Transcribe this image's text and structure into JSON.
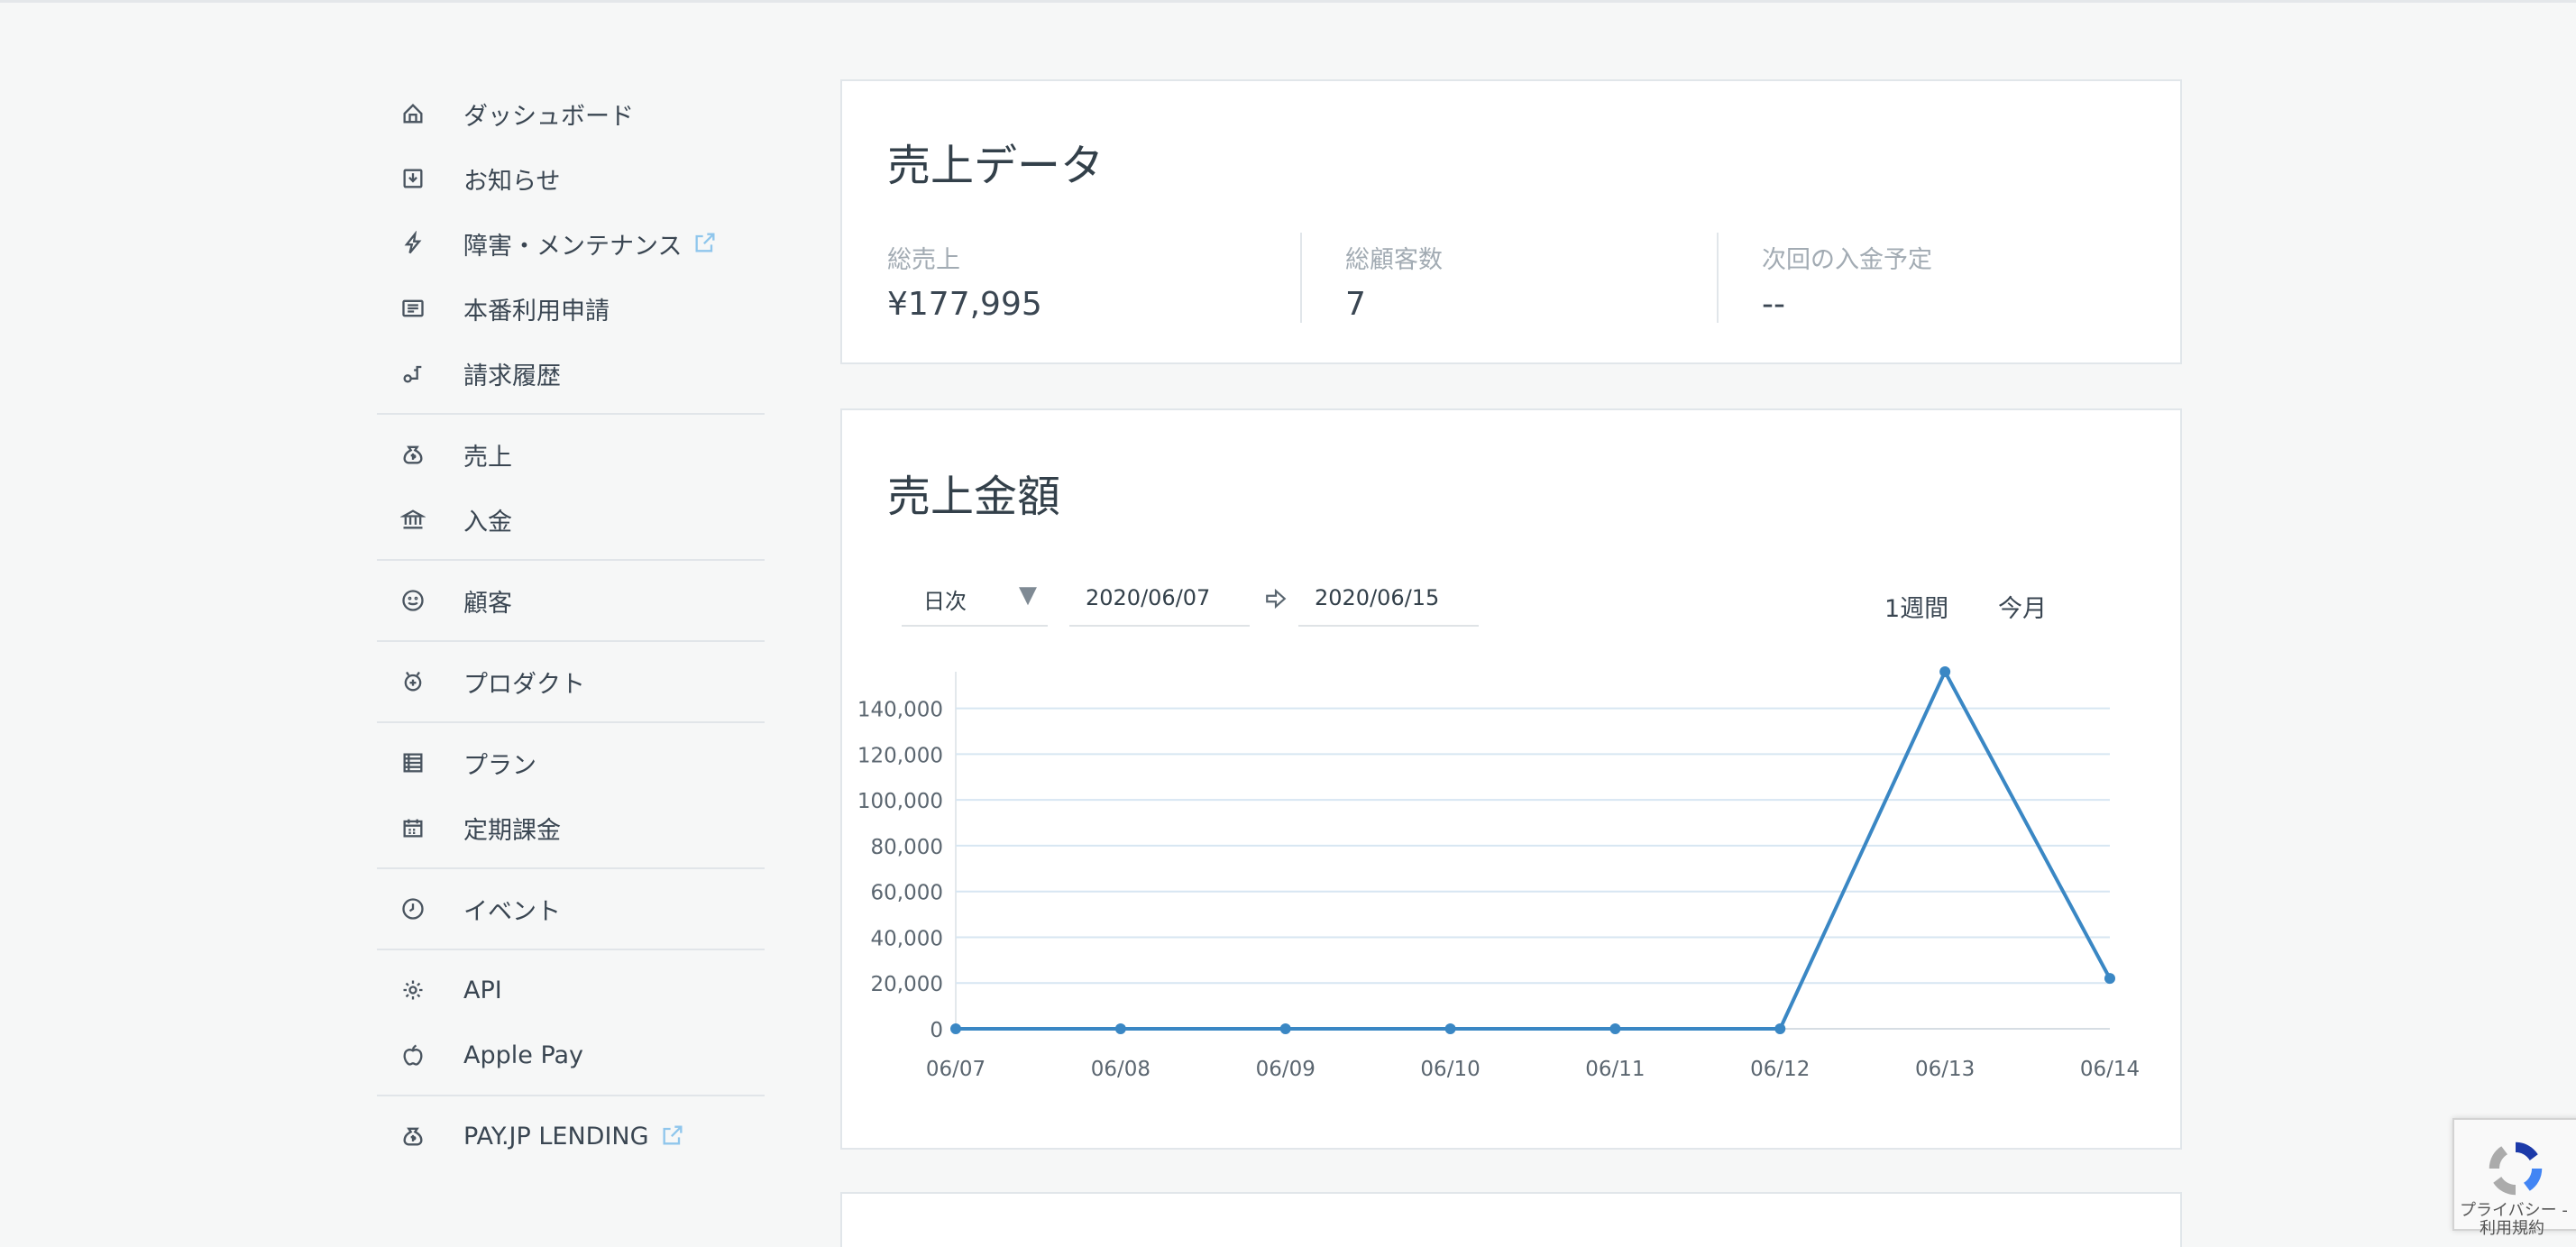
{
  "sidebar": {
    "groups": [
      [
        {
          "label": "ダッシュボード",
          "icon": "home-icon"
        },
        {
          "label": "お知らせ",
          "icon": "inbox-icon"
        },
        {
          "label": "障害・メンテナンス",
          "icon": "lightning-icon",
          "external": true
        },
        {
          "label": "本番利用申請",
          "icon": "document-icon"
        },
        {
          "label": "請求履歴",
          "icon": "billing-icon"
        }
      ],
      [
        {
          "label": "売上",
          "icon": "money-bag-icon"
        },
        {
          "label": "入金",
          "icon": "bank-icon"
        }
      ],
      [
        {
          "label": "顧客",
          "icon": "smiley-icon"
        }
      ],
      [
        {
          "label": "プロダクト",
          "icon": "product-icon"
        }
      ],
      [
        {
          "label": "プラン",
          "icon": "list-icon"
        },
        {
          "label": "定期課金",
          "icon": "calendar-icon"
        }
      ],
      [
        {
          "label": "イベント",
          "icon": "clock-icon"
        }
      ],
      [
        {
          "label": "API",
          "icon": "gear-icon"
        },
        {
          "label": "Apple Pay",
          "icon": "apple-icon"
        }
      ],
      [
        {
          "label": "PAY.JP LENDING",
          "icon": "money-bag-icon",
          "external": true
        }
      ]
    ]
  },
  "sales_data": {
    "title": "売上データ",
    "stats": [
      {
        "label": "総売上",
        "value": "¥177,995"
      },
      {
        "label": "総顧客数",
        "value": "7"
      },
      {
        "label": "次回の入金予定",
        "value": "--"
      }
    ]
  },
  "sales_amount": {
    "title": "売上金額",
    "interval_select": "日次",
    "start_date": "2020/06/07",
    "end_date": "2020/06/15",
    "range_week": "1週間",
    "range_month": "今月"
  },
  "chart_data": {
    "type": "line",
    "categories": [
      "06/07",
      "06/08",
      "06/09",
      "06/10",
      "06/11",
      "06/12",
      "06/13",
      "06/14"
    ],
    "values": [
      0,
      0,
      0,
      0,
      0,
      0,
      156000,
      22000
    ],
    "yticks": [
      0,
      20000,
      40000,
      60000,
      80000,
      100000,
      120000,
      140000
    ],
    "ylim": [
      0,
      156000
    ],
    "grid": true,
    "color": "#3a87c4"
  },
  "recaptcha": {
    "privacy": "プライバシー - ",
    "terms": "利用規約"
  },
  "colors": {
    "accent": "#3a87c4",
    "external_link": "#8fc6ec"
  }
}
